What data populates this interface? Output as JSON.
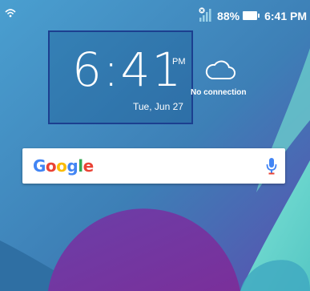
{
  "status_bar": {
    "battery_percent": "88%",
    "time": "6:41 PM",
    "wifi_icon": "wifi-calling-icon",
    "signal_icon": "signal-no-connection-icon",
    "battery_icon": "battery-icon"
  },
  "clock": {
    "time": "6:41",
    "ampm": "PM",
    "date": "Tue, Jun 27"
  },
  "weather": {
    "status": "No connection",
    "icon": "cloud-icon"
  },
  "search": {
    "logo_letters": [
      "G",
      "o",
      "o",
      "g",
      "l",
      "e"
    ],
    "logo_colors": [
      "#4285F4",
      "#EA4335",
      "#FBBC05",
      "#4285F4",
      "#34A853",
      "#EA4335"
    ],
    "mic_color": "#4285F4"
  }
}
